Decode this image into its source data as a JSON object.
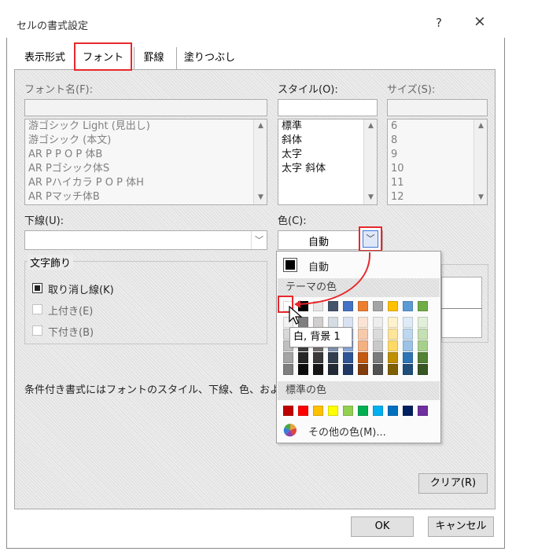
{
  "window": {
    "title": "セルの書式設定",
    "help": "?",
    "close": "×"
  },
  "tabs": [
    {
      "label": "表示形式"
    },
    {
      "label": "フォント"
    },
    {
      "label": "罫線"
    },
    {
      "label": "塗りつぶし"
    }
  ],
  "font": {
    "name_label": "フォント名(F):",
    "style_label": "スタイル(O):",
    "size_label": "サイズ(S):",
    "fonts": [
      "游ゴシック Light (見出し)",
      "游ゴシック (本文)",
      "AR P P O P 体B",
      "AR Pゴシック体S",
      "AR Pハイカラ P O P 体H",
      "AR Pマッチ体B"
    ],
    "styles": [
      "標準",
      "斜体",
      "太字",
      "太字 斜体"
    ],
    "sizes": [
      "6",
      "8",
      "9",
      "10",
      "11",
      "12"
    ]
  },
  "underline": {
    "label": "下線(U):",
    "value": ""
  },
  "color": {
    "label": "色(C):",
    "value": "自動"
  },
  "effects": {
    "title": "文字飾り",
    "strikethrough": "取り消し線(K)",
    "superscript": "上付き(E)",
    "subscript": "下付き(B)"
  },
  "note": "条件付き書式にはフォントのスタイル、下線、色、および取",
  "palette": {
    "auto_label": "自動",
    "theme_header": "テーマの色",
    "standard_header": "標準の色",
    "more_colors": "その他の色(M)...",
    "tooltip": "白, 背景 1",
    "theme_top": [
      "#ffffff",
      "#000000",
      "#e7e6e6",
      "#44546a",
      "#4472c4",
      "#ed7d31",
      "#a5a5a5",
      "#ffc000",
      "#5b9bd5",
      "#70ad47"
    ],
    "theme_shades": [
      [
        "#f2f2f2",
        "#7f7f7f",
        "#d0cece",
        "#d6dce4",
        "#d9e2f3",
        "#fbe4d5",
        "#ededed",
        "#fff2cc",
        "#deebf6",
        "#e2efd9"
      ],
      [
        "#d8d8d8",
        "#595959",
        "#aeabab",
        "#adb9ca",
        "#b4c6e7",
        "#f7caac",
        "#dbdbdb",
        "#fee599",
        "#bdd7ee",
        "#c5e0b3"
      ],
      [
        "#bfbfbf",
        "#3f3f3f",
        "#757070",
        "#8496b0",
        "#8eaadb",
        "#f4b083",
        "#c9c9c9",
        "#ffd966",
        "#9cc3e5",
        "#a8d08d"
      ],
      [
        "#a5a5a5",
        "#262626",
        "#3a3838",
        "#333f4f",
        "#2f5496",
        "#c45911",
        "#7b7b7b",
        "#bf9000",
        "#2e75b5",
        "#538135"
      ],
      [
        "#7f7f7f",
        "#0c0c0c",
        "#171616",
        "#222a35",
        "#1f3864",
        "#833c0b",
        "#525252",
        "#7f6000",
        "#1e4e79",
        "#375623"
      ]
    ],
    "standard": [
      "#c00000",
      "#ff0000",
      "#ffc000",
      "#ffff00",
      "#92d050",
      "#00b050",
      "#00b0f0",
      "#0070c0",
      "#002060",
      "#7030a0"
    ]
  },
  "buttons": {
    "clear": "クリア(R)",
    "ok": "OK",
    "cancel": "キャンセル"
  },
  "colors": {
    "highlight": "#e8282c",
    "accent": "#3c78d8"
  }
}
